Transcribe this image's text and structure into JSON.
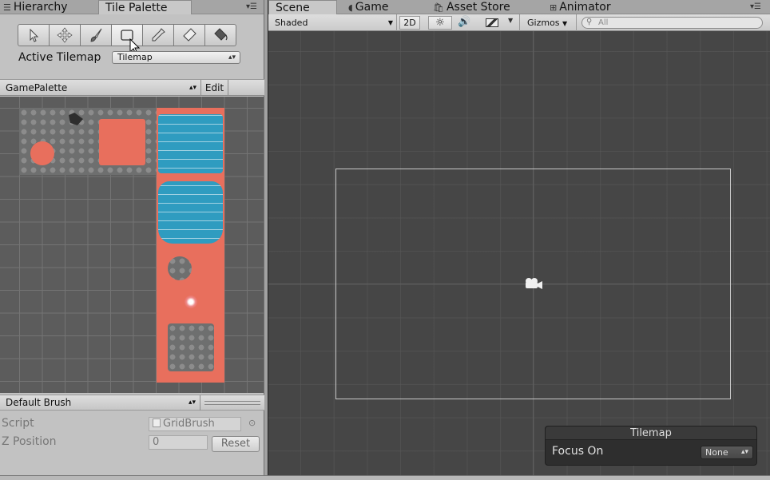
{
  "left_tabs": {
    "hierarchy": "Hierarchy",
    "tile_palette": "Tile Palette"
  },
  "toolbar": {
    "tools": [
      "select-tool",
      "move-tool",
      "paint-tool",
      "box-fill-tool",
      "picker-tool",
      "erase-tool",
      "flood-fill-tool"
    ],
    "active_tool": "box-fill-tool"
  },
  "active_tilemap": {
    "label": "Active Tilemap",
    "value": "Tilemap"
  },
  "palette": {
    "name": "GamePalette",
    "edit_label": "Edit"
  },
  "brush": {
    "name": "Default Brush",
    "script_label": "Script",
    "script_value": "GridBrush",
    "z_label": "Z Position",
    "z_value": "0",
    "reset_label": "Reset"
  },
  "right_tabs": {
    "scene": "Scene",
    "game": "Game",
    "asset_store": "Asset Store",
    "animator": "Animator"
  },
  "scene_toolbar": {
    "shading": "Shaded",
    "mode_2d": "2D",
    "gizmos": "Gizmos",
    "search_placeholder": "All"
  },
  "tilemap_overlay": {
    "title": "Tilemap",
    "focus_label": "Focus On",
    "focus_value": "None"
  },
  "colors": {
    "tile_red": "#e86f5d",
    "tile_water": "#2f9cc0",
    "scene_bg": "#464646"
  }
}
